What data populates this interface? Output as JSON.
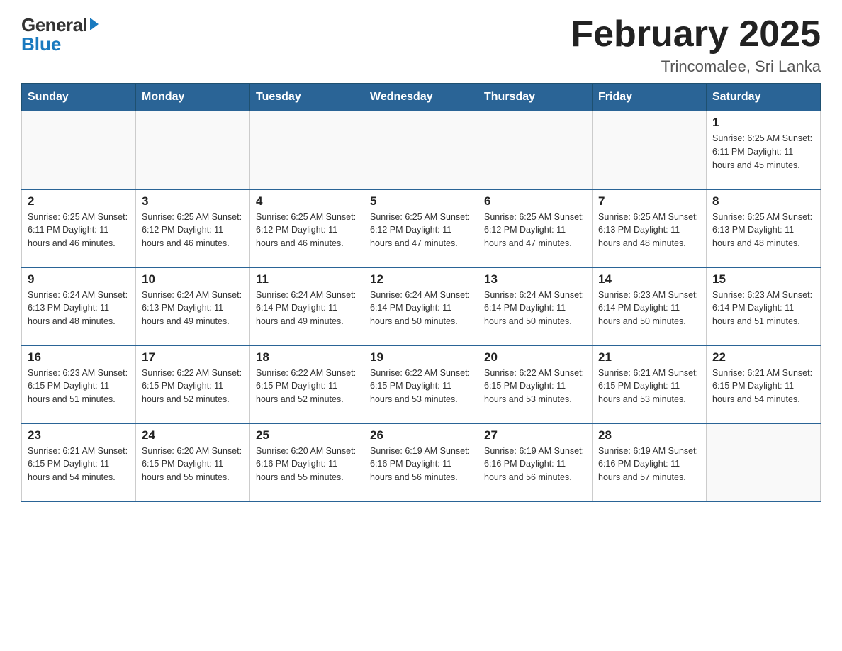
{
  "header": {
    "logo_general": "General",
    "logo_blue": "Blue",
    "month_title": "February 2025",
    "location": "Trincomalee, Sri Lanka"
  },
  "days_of_week": [
    "Sunday",
    "Monday",
    "Tuesday",
    "Wednesday",
    "Thursday",
    "Friday",
    "Saturday"
  ],
  "weeks": [
    [
      {
        "day": "",
        "info": ""
      },
      {
        "day": "",
        "info": ""
      },
      {
        "day": "",
        "info": ""
      },
      {
        "day": "",
        "info": ""
      },
      {
        "day": "",
        "info": ""
      },
      {
        "day": "",
        "info": ""
      },
      {
        "day": "1",
        "info": "Sunrise: 6:25 AM\nSunset: 6:11 PM\nDaylight: 11 hours\nand 45 minutes."
      }
    ],
    [
      {
        "day": "2",
        "info": "Sunrise: 6:25 AM\nSunset: 6:11 PM\nDaylight: 11 hours\nand 46 minutes."
      },
      {
        "day": "3",
        "info": "Sunrise: 6:25 AM\nSunset: 6:12 PM\nDaylight: 11 hours\nand 46 minutes."
      },
      {
        "day": "4",
        "info": "Sunrise: 6:25 AM\nSunset: 6:12 PM\nDaylight: 11 hours\nand 46 minutes."
      },
      {
        "day": "5",
        "info": "Sunrise: 6:25 AM\nSunset: 6:12 PM\nDaylight: 11 hours\nand 47 minutes."
      },
      {
        "day": "6",
        "info": "Sunrise: 6:25 AM\nSunset: 6:12 PM\nDaylight: 11 hours\nand 47 minutes."
      },
      {
        "day": "7",
        "info": "Sunrise: 6:25 AM\nSunset: 6:13 PM\nDaylight: 11 hours\nand 48 minutes."
      },
      {
        "day": "8",
        "info": "Sunrise: 6:25 AM\nSunset: 6:13 PM\nDaylight: 11 hours\nand 48 minutes."
      }
    ],
    [
      {
        "day": "9",
        "info": "Sunrise: 6:24 AM\nSunset: 6:13 PM\nDaylight: 11 hours\nand 48 minutes."
      },
      {
        "day": "10",
        "info": "Sunrise: 6:24 AM\nSunset: 6:13 PM\nDaylight: 11 hours\nand 49 minutes."
      },
      {
        "day": "11",
        "info": "Sunrise: 6:24 AM\nSunset: 6:14 PM\nDaylight: 11 hours\nand 49 minutes."
      },
      {
        "day": "12",
        "info": "Sunrise: 6:24 AM\nSunset: 6:14 PM\nDaylight: 11 hours\nand 50 minutes."
      },
      {
        "day": "13",
        "info": "Sunrise: 6:24 AM\nSunset: 6:14 PM\nDaylight: 11 hours\nand 50 minutes."
      },
      {
        "day": "14",
        "info": "Sunrise: 6:23 AM\nSunset: 6:14 PM\nDaylight: 11 hours\nand 50 minutes."
      },
      {
        "day": "15",
        "info": "Sunrise: 6:23 AM\nSunset: 6:14 PM\nDaylight: 11 hours\nand 51 minutes."
      }
    ],
    [
      {
        "day": "16",
        "info": "Sunrise: 6:23 AM\nSunset: 6:15 PM\nDaylight: 11 hours\nand 51 minutes."
      },
      {
        "day": "17",
        "info": "Sunrise: 6:22 AM\nSunset: 6:15 PM\nDaylight: 11 hours\nand 52 minutes."
      },
      {
        "day": "18",
        "info": "Sunrise: 6:22 AM\nSunset: 6:15 PM\nDaylight: 11 hours\nand 52 minutes."
      },
      {
        "day": "19",
        "info": "Sunrise: 6:22 AM\nSunset: 6:15 PM\nDaylight: 11 hours\nand 53 minutes."
      },
      {
        "day": "20",
        "info": "Sunrise: 6:22 AM\nSunset: 6:15 PM\nDaylight: 11 hours\nand 53 minutes."
      },
      {
        "day": "21",
        "info": "Sunrise: 6:21 AM\nSunset: 6:15 PM\nDaylight: 11 hours\nand 53 minutes."
      },
      {
        "day": "22",
        "info": "Sunrise: 6:21 AM\nSunset: 6:15 PM\nDaylight: 11 hours\nand 54 minutes."
      }
    ],
    [
      {
        "day": "23",
        "info": "Sunrise: 6:21 AM\nSunset: 6:15 PM\nDaylight: 11 hours\nand 54 minutes."
      },
      {
        "day": "24",
        "info": "Sunrise: 6:20 AM\nSunset: 6:15 PM\nDaylight: 11 hours\nand 55 minutes."
      },
      {
        "day": "25",
        "info": "Sunrise: 6:20 AM\nSunset: 6:16 PM\nDaylight: 11 hours\nand 55 minutes."
      },
      {
        "day": "26",
        "info": "Sunrise: 6:19 AM\nSunset: 6:16 PM\nDaylight: 11 hours\nand 56 minutes."
      },
      {
        "day": "27",
        "info": "Sunrise: 6:19 AM\nSunset: 6:16 PM\nDaylight: 11 hours\nand 56 minutes."
      },
      {
        "day": "28",
        "info": "Sunrise: 6:19 AM\nSunset: 6:16 PM\nDaylight: 11 hours\nand 57 minutes."
      },
      {
        "day": "",
        "info": ""
      }
    ]
  ]
}
